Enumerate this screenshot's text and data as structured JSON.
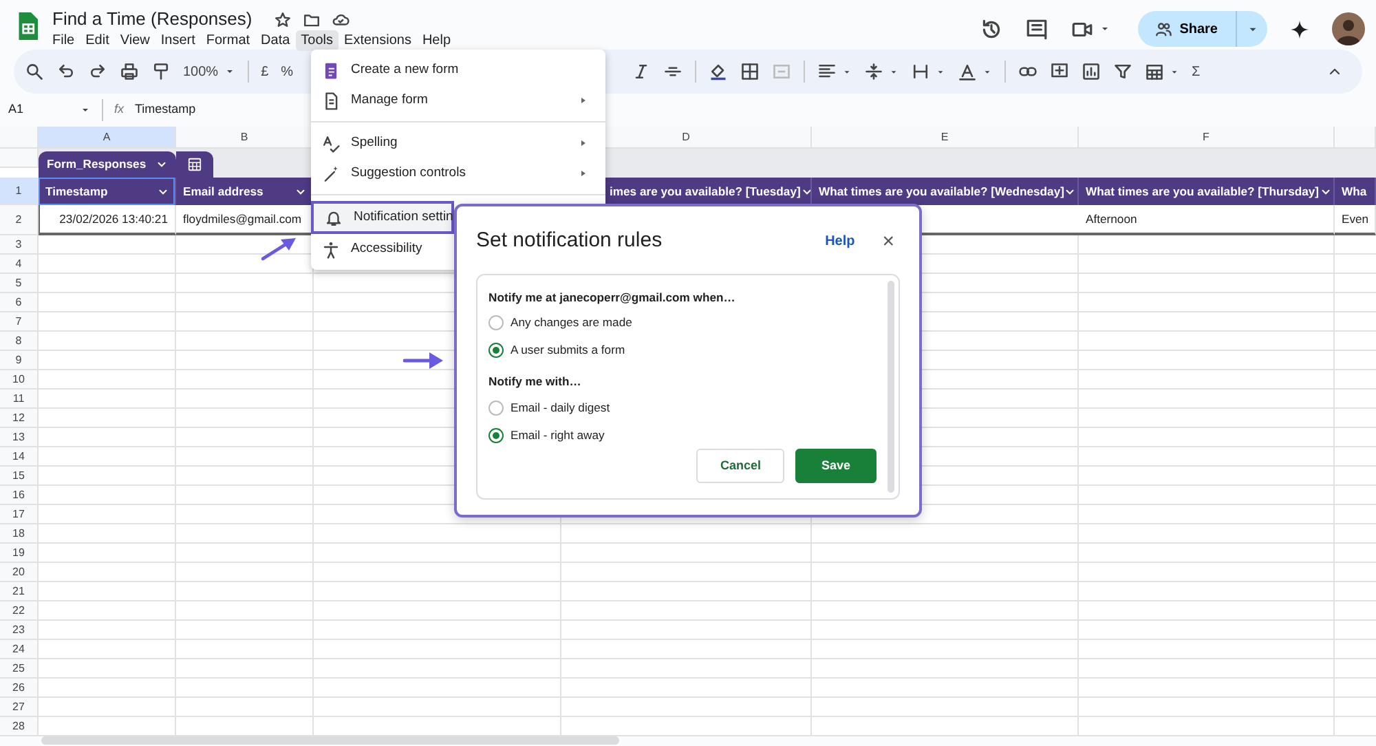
{
  "document": {
    "title": "Find a Time (Responses)"
  },
  "menu_bar": [
    {
      "label": "File",
      "selected": false
    },
    {
      "label": "Edit",
      "selected": false
    },
    {
      "label": "View",
      "selected": false
    },
    {
      "label": "Insert",
      "selected": false
    },
    {
      "label": "Format",
      "selected": false
    },
    {
      "label": "Data",
      "selected": false
    },
    {
      "label": "Tools",
      "selected": true
    },
    {
      "label": "Extensions",
      "selected": false
    },
    {
      "label": "Help",
      "selected": false
    }
  ],
  "share_button": {
    "label": "Share"
  },
  "toolbar": {
    "zoom": "100%",
    "currency": "£",
    "percent": "%",
    "sum": "Σ"
  },
  "formula_bar": {
    "cell_reference": "A1",
    "function_label": "fx",
    "value": "Timestamp"
  },
  "columns": [
    {
      "letter": "A",
      "selected": true
    },
    {
      "letter": "B",
      "selected": false
    },
    null,
    {
      "letter": "D",
      "selected": false
    },
    {
      "letter": "E",
      "selected": false
    },
    {
      "letter": "F",
      "selected": false
    },
    {
      "selected": false
    }
  ],
  "table": {
    "name": "Form_Responses"
  },
  "rows": [
    {
      "number": "1",
      "selected": true,
      "kind": "header",
      "cells": [
        {
          "text": "Timestamp",
          "dropdown": true
        },
        {
          "text": "Email address",
          "dropdown": true
        },
        null,
        {
          "text": "imes are you available? [Tuesday]",
          "dropdown": true
        },
        {
          "text": "What times are you available? [Wednesday]",
          "dropdown": true
        },
        {
          "text": "What times are you available? [Thursday]",
          "dropdown": true
        },
        {
          "text": "Wha",
          "dropdown": false
        }
      ]
    },
    {
      "number": "2",
      "selected": false,
      "kind": "data",
      "cells": [
        "23/02/2026 13:40:21",
        "floydmiles@gmail.com",
        null,
        null,
        null,
        "Afternoon",
        "Even"
      ]
    }
  ],
  "empty_rows": [
    "3",
    "4",
    "5",
    "6",
    "7",
    "8",
    "9",
    "10",
    "11",
    "12",
    "13",
    "14",
    "15",
    "16",
    "17",
    "18",
    "19",
    "20",
    "21",
    "22",
    "23",
    "24",
    "25",
    "26",
    "27",
    "28"
  ],
  "tools_menu": {
    "items": [
      {
        "kind": "item",
        "label": "Create a new form",
        "submenu": false,
        "highlighted": false
      },
      {
        "kind": "item",
        "label": "Manage form",
        "submenu": true,
        "highlighted": false
      },
      {
        "kind": "divider"
      },
      {
        "kind": "item",
        "label": "Spelling",
        "submenu": true,
        "highlighted": false
      },
      {
        "kind": "item",
        "label": "Suggestion controls",
        "submenu": true,
        "highlighted": false
      },
      {
        "kind": "divider"
      },
      {
        "kind": "item",
        "label": "Notification settin",
        "submenu": false,
        "highlighted": true
      },
      {
        "kind": "item",
        "label": "Accessibility",
        "submenu": false,
        "highlighted": false
      }
    ]
  },
  "dialog": {
    "title": "Set notification rules",
    "help": "Help",
    "close": "×",
    "sections": [
      {
        "heading": "Notify me at janecoperr@gmail.com when…",
        "options": [
          {
            "label": "Any changes are made",
            "selected": false
          },
          {
            "label": "A user submits a form",
            "selected": true
          }
        ]
      },
      {
        "heading": "Notify me with…",
        "options": [
          {
            "label": "Email - daily digest",
            "selected": false
          },
          {
            "label": "Email - right away",
            "selected": true
          }
        ]
      }
    ],
    "buttons": [
      {
        "label": "Cancel",
        "kind": "secondary"
      },
      {
        "label": "Save",
        "kind": "primary"
      }
    ]
  }
}
